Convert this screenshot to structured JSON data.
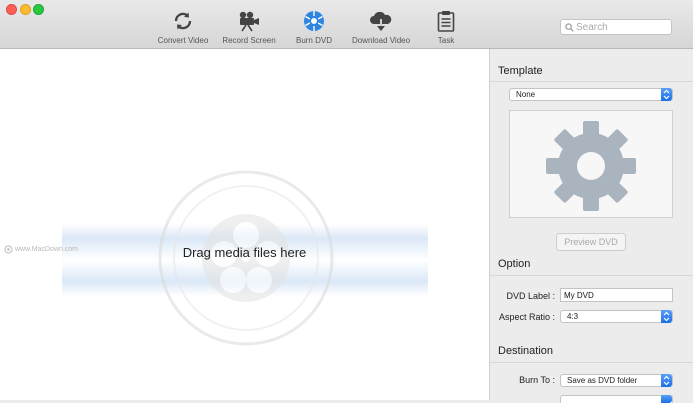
{
  "toolbar": {
    "items": [
      {
        "label": "Convert Video",
        "icon": "convert-icon"
      },
      {
        "label": "Record Screen",
        "icon": "camera-icon"
      },
      {
        "label": "Burn DVD",
        "icon": "disc-icon"
      },
      {
        "label": "Download Video",
        "icon": "cloud-download-icon"
      },
      {
        "label": "Task",
        "icon": "clipboard-icon"
      }
    ]
  },
  "search": {
    "placeholder": "Search"
  },
  "dropzone": {
    "text": "Drag media files here",
    "watermark": "www.MacDown.com"
  },
  "panel": {
    "template_title": "Template",
    "template_value": "None",
    "preview_button": "Preview DVD",
    "option_title": "Option",
    "dvd_label_label": "DVD Label :",
    "dvd_label_value": "My DVD",
    "aspect_label": "Aspect Ratio :",
    "aspect_value": "4:3",
    "destination_title": "Destination",
    "burn_to_label": "Burn To :",
    "burn_to_value": "Save as DVD folder"
  },
  "colors": {
    "accent": "#1a6ee8",
    "burn_dvd_active": "#2e86e0"
  }
}
